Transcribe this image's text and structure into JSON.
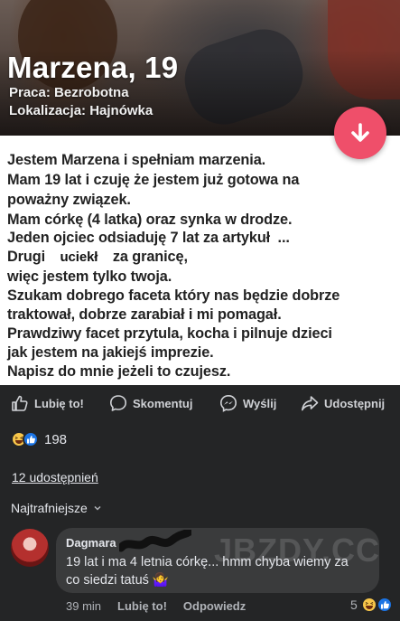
{
  "profile": {
    "name": "Marzena, 19",
    "job": "Praca: Bezrobotna",
    "location": "Lokalizacja: Hajnówka"
  },
  "post": {
    "lines": [
      "Jestem Marzena i spełniam marzenia.",
      "Mam 19 lat i czuję że jestem już gotowa na",
      "poważny związek.",
      "Mam córkę (4 latka) oraz synka w drodze.",
      "Jeden ojciec odsiaduję 7 lat za artykuł",
      "...",
      "Drugi",
      "uciekł",
      "za granicę,",
      "więc jestem tylko twoja.",
      "Szukam dobrego faceta który nas będzie dobrze",
      "traktował, dobrze zarabiał i mi pomagał.",
      "Prawdziwy facet przytula, kocha i pilnuje dzieci",
      "jak jestem na jakiejś imprezie.",
      "Napisz do mnie jeżeli to czujesz."
    ]
  },
  "actions": {
    "like": "Lubię to!",
    "comment": "Skomentuj",
    "send": "Wyślij",
    "share": "Udostępnij"
  },
  "reactions": {
    "count": "198"
  },
  "shares_text": "12 udostępnień",
  "sort_label": "Najtrafniejsze",
  "watermark": "JBZDY.CC",
  "comment": {
    "author": "Dagmara",
    "text": "19 lat i ma 4 letnia córkę... hmm chyba wiemy za co siedzi tatuś 🤷‍♀️",
    "time": "39 min",
    "like": "Lubię to!",
    "reply": "Odpowiedz",
    "reaction_count": "5"
  },
  "colors": {
    "brand_pink": "#ef4f6a",
    "like_blue": "#1b74e4",
    "dark_bg": "#242526",
    "bubble_bg": "#3a3b3c"
  }
}
